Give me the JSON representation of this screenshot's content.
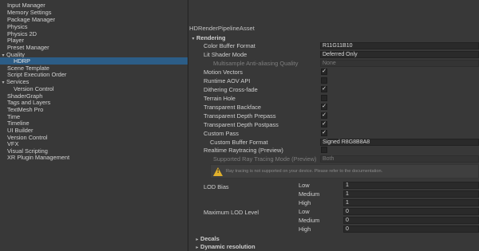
{
  "sidebar": {
    "items": [
      {
        "label": "Input Manager",
        "indent": 0,
        "expander": "",
        "selected": false
      },
      {
        "label": "Memory Settings",
        "indent": 0,
        "expander": "",
        "selected": false
      },
      {
        "label": "Package Manager",
        "indent": 0,
        "expander": "",
        "selected": false
      },
      {
        "label": "Physics",
        "indent": 0,
        "expander": "",
        "selected": false
      },
      {
        "label": "Physics 2D",
        "indent": 0,
        "expander": "",
        "selected": false
      },
      {
        "label": "Player",
        "indent": 0,
        "expander": "",
        "selected": false
      },
      {
        "label": "Preset Manager",
        "indent": 0,
        "expander": "",
        "selected": false
      },
      {
        "label": "Quality",
        "indent": 0,
        "expander": "▾",
        "selected": false
      },
      {
        "label": "HDRP",
        "indent": 1,
        "expander": "",
        "selected": true
      },
      {
        "label": "Scene Template",
        "indent": 0,
        "expander": "",
        "selected": false
      },
      {
        "label": "Script Execution Order",
        "indent": 0,
        "expander": "",
        "selected": false
      },
      {
        "label": "Services",
        "indent": 0,
        "expander": "▾",
        "selected": false
      },
      {
        "label": "Version Control",
        "indent": 1,
        "expander": "",
        "selected": false
      },
      {
        "label": "ShaderGraph",
        "indent": 0,
        "expander": "",
        "selected": false
      },
      {
        "label": "Tags and Layers",
        "indent": 0,
        "expander": "",
        "selected": false
      },
      {
        "label": "TextMesh Pro",
        "indent": 0,
        "expander": "",
        "selected": false
      },
      {
        "label": "Time",
        "indent": 0,
        "expander": "",
        "selected": false
      },
      {
        "label": "Timeline",
        "indent": 0,
        "expander": "",
        "selected": false
      },
      {
        "label": "UI Builder",
        "indent": 0,
        "expander": "",
        "selected": false
      },
      {
        "label": "Version Control",
        "indent": 0,
        "expander": "",
        "selected": false
      },
      {
        "label": "VFX",
        "indent": 0,
        "expander": "",
        "selected": false
      },
      {
        "label": "Visual Scripting",
        "indent": 0,
        "expander": "",
        "selected": false
      },
      {
        "label": "XR Plugin Management",
        "indent": 0,
        "expander": "",
        "selected": false
      }
    ]
  },
  "asset_title": "HDRenderPipelineAsset",
  "rendering": {
    "header": "Rendering",
    "expander": "▾",
    "color_buffer_format": {
      "label": "Color Buffer Format",
      "value": "R11G11B10"
    },
    "lit_shader_mode": {
      "label": "Lit Shader Mode",
      "value": "Deferred Only"
    },
    "msaa_quality": {
      "label": "Multisample Anti-aliasing Quality",
      "value": "None"
    },
    "motion_vectors": {
      "label": "Motion Vectors",
      "checked": true
    },
    "runtime_aov_api": {
      "label": "Runtime AOV API",
      "checked": false
    },
    "dithering_cross_fade": {
      "label": "Dithering Cross-fade",
      "checked": true
    },
    "terrain_hole": {
      "label": "Terrain Hole",
      "checked": false
    },
    "transparent_backface": {
      "label": "Transparent Backface",
      "checked": true
    },
    "transparent_depth_prepass": {
      "label": "Transparent Depth Prepass",
      "checked": true
    },
    "transparent_depth_postpass": {
      "label": "Transparent Depth Postpass",
      "checked": true
    },
    "custom_pass": {
      "label": "Custom Pass",
      "checked": true
    },
    "custom_buffer_format": {
      "label": "Custom Buffer Format",
      "value": "Signed R8G8B8A8"
    },
    "realtime_raytracing": {
      "label": "Realtime Raytracing (Preview)",
      "checked": false
    },
    "supported_ray_tracing_mode": {
      "label": "Supported Ray Tracing Mode (Preview)",
      "value": "Both"
    },
    "warning": "Ray tracing is not supported on your device. Please refer to the documentation.",
    "lod_bias": {
      "label": "LOD Bias",
      "levels": [
        {
          "name": "Low",
          "value": "1"
        },
        {
          "name": "Medium",
          "value": "1"
        },
        {
          "name": "High",
          "value": "1"
        }
      ]
    },
    "max_lod_level": {
      "label": "Maximum LOD Level",
      "levels": [
        {
          "name": "Low",
          "value": "0"
        },
        {
          "name": "Medium",
          "value": "0"
        },
        {
          "name": "High",
          "value": "0"
        }
      ]
    }
  },
  "collapsed_sections": [
    {
      "label": "Decals",
      "expander": "▸"
    },
    {
      "label": "Dynamic resolution",
      "expander": "▸"
    }
  ],
  "colors": {
    "selection": "#2c5d87",
    "background": "#383838",
    "warning": "#e0b02c"
  }
}
